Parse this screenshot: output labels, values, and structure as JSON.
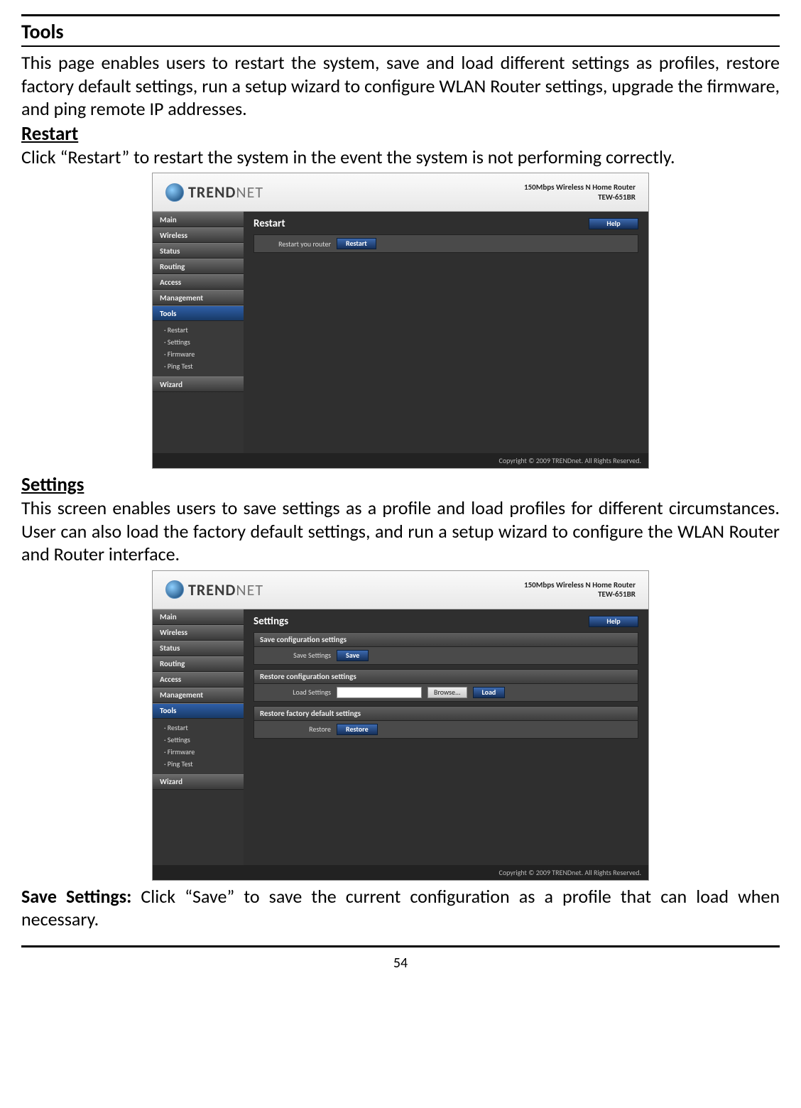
{
  "page": {
    "number": "54",
    "section_title": "Tools",
    "intro": "This page enables users to restart the system, save and load different settings as profiles, restore factory default settings, run a setup wizard to configure WLAN Router settings, upgrade the firmware, and ping remote IP addresses.",
    "restart_heading": "Restart",
    "restart_text": "Click “Restart” to restart the system in the event the system is not performing correctly.",
    "settings_heading": "Settings",
    "settings_text": "This screen enables users to save settings as a profile and load profiles for different circumstances. User can also load the factory default settings, and run a setup wizard to configure the WLAN Router and Router interface.",
    "save_settings_label": "Save Settings:",
    "save_settings_text": " Click “Save” to save the current configuration as a profile that can load when necessary."
  },
  "router": {
    "brand_a": "TREND",
    "brand_b": "NET",
    "model_line1": "150Mbps Wireless N Home Router",
    "model_line2": "TEW-651BR",
    "copyright": "Copyright © 2009 TRENDnet. All Rights Reserved.",
    "help": "Help",
    "nav": {
      "main": "Main",
      "wireless": "Wireless",
      "status": "Status",
      "routing": "Routing",
      "access": "Access",
      "management": "Management",
      "tools": "Tools",
      "wizard": "Wizard"
    },
    "subnav": {
      "restart": "Restart",
      "settings": "Settings",
      "firmware": "Firmware",
      "ping": "Ping Test"
    },
    "restart_panel": {
      "title": "Restart",
      "row_label": "Restart you router",
      "button": "Restart"
    },
    "settings_panel": {
      "title": "Settings",
      "save_bar": "Save configuration settings",
      "save_label": "Save Settings",
      "save_button": "Save",
      "restore_bar": "Restore configuration settings",
      "load_label": "Load Settings",
      "browse": "Browse...",
      "load_button": "Load",
      "factory_bar": "Restore factory default settings",
      "restore_label": "Restore",
      "restore_button": "Restore"
    }
  }
}
